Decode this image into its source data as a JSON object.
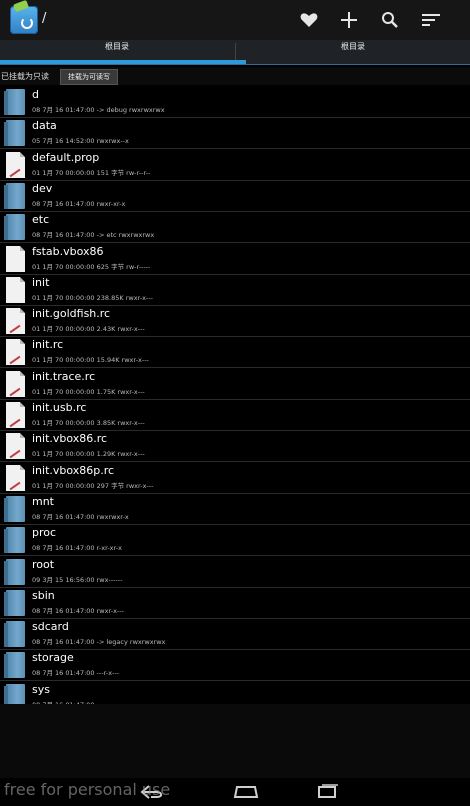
{
  "actionbar": {
    "title": "/",
    "icons": [
      "favorite-icon",
      "add-icon",
      "search-icon",
      "sort-icon"
    ]
  },
  "tabs": {
    "left_label": "根目录",
    "right_label": "根目录"
  },
  "mount": {
    "status_text": "已挂载为只读",
    "button_label": "挂载为可读写"
  },
  "files": [
    {
      "name": "d",
      "meta": "08 7月 16 01:47:00  -> debug  rwxrwxrwx",
      "type": "folder"
    },
    {
      "name": "data",
      "meta": "05 7月 16 14:52:00   rwxrwx--x",
      "type": "folder"
    },
    {
      "name": "default.prop",
      "meta": "01 1月 70 00:00:00  151 字节  rw-r--r--",
      "type": "file-red"
    },
    {
      "name": "dev",
      "meta": "08 7月 16 01:47:00   rwxr-xr-x",
      "type": "folder"
    },
    {
      "name": "etc",
      "meta": "08 7月 16 01:47:00  -> etc  rwxrwxrwx",
      "type": "folder"
    },
    {
      "name": "fstab.vbox86",
      "meta": "01 1月 70 00:00:00  625 字节  rw-r-----",
      "type": "file"
    },
    {
      "name": "init",
      "meta": "01 1月 70 00:00:00  238.85K  rwxr-x---",
      "type": "file"
    },
    {
      "name": "init.goldfish.rc",
      "meta": "01 1月 70 00:00:00  2.43K  rwxr-x---",
      "type": "file-red"
    },
    {
      "name": "init.rc",
      "meta": "01 1月 70 00:00:00  15.94K  rwxr-x---",
      "type": "file-red"
    },
    {
      "name": "init.trace.rc",
      "meta": "01 1月 70 00:00:00  1.75K  rwxr-x---",
      "type": "file-red"
    },
    {
      "name": "init.usb.rc",
      "meta": "01 1月 70 00:00:00  3.85K  rwxr-x---",
      "type": "file-red"
    },
    {
      "name": "init.vbox86.rc",
      "meta": "01 1月 70 00:00:00  1.29K  rwxr-x---",
      "type": "file-red"
    },
    {
      "name": "init.vbox86p.rc",
      "meta": "01 1月 70 00:00:00  297 字节  rwxr-x---",
      "type": "file-red"
    },
    {
      "name": "mnt",
      "meta": "08 7月 16 01:47:00   rwxrwxr-x",
      "type": "folder"
    },
    {
      "name": "proc",
      "meta": "08 7月 16 01:47:00   r-xr-xr-x",
      "type": "folder"
    },
    {
      "name": "root",
      "meta": "09 3月 15 16:56:00   rwx------",
      "type": "folder"
    },
    {
      "name": "sbin",
      "meta": "08 7月 16 01:47:00   rwxr-x---",
      "type": "folder"
    },
    {
      "name": "sdcard",
      "meta": "08 7月 16 01:47:00  -> legacy  rwxrwxrwx",
      "type": "folder"
    },
    {
      "name": "storage",
      "meta": "08 7月 16 01:47:00   ---r-x---",
      "type": "folder"
    },
    {
      "name": "sys",
      "meta": "08 7月 16 01:47:00",
      "type": "folder"
    }
  ],
  "watermark": "free for personal use",
  "navbar": {
    "icons": [
      "back-icon",
      "home-icon",
      "recent-apps-icon"
    ]
  }
}
